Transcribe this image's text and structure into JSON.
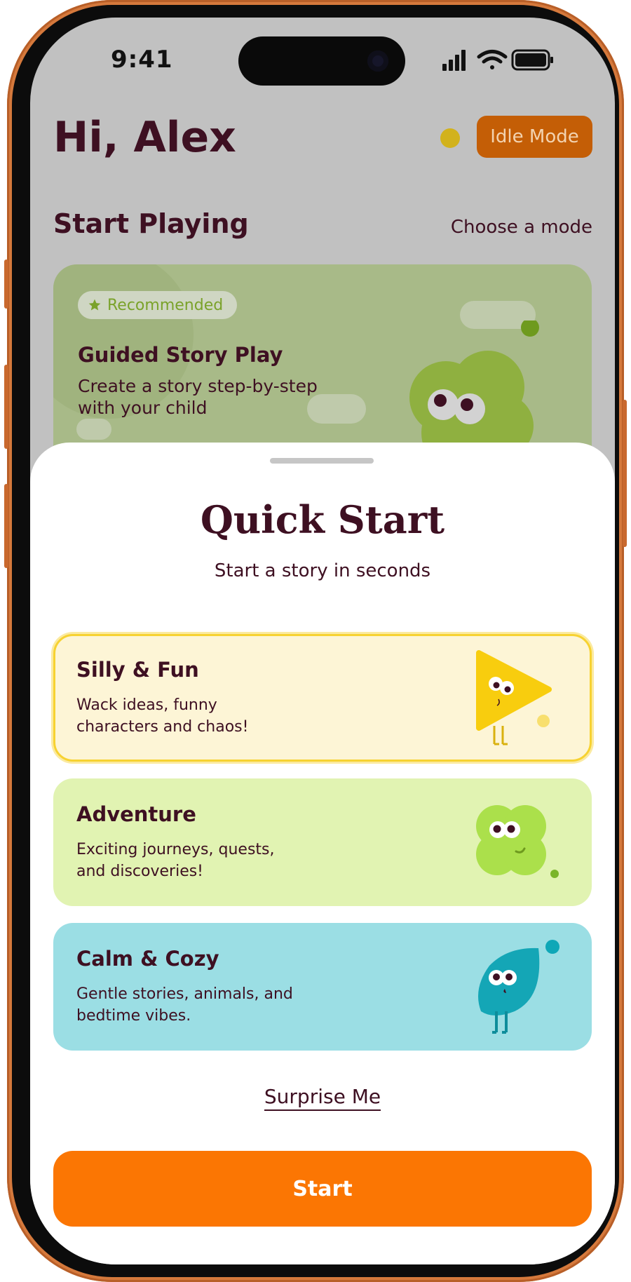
{
  "status_bar": {
    "time": "9:41"
  },
  "header": {
    "greeting": "Hi, Alex",
    "idle_button": "Idle Mode"
  },
  "section": {
    "title": "Start Playing",
    "link": "Choose a mode"
  },
  "recommended_card": {
    "badge": "Recommended",
    "title": "Guided Story Play",
    "description": "Create a story step-by-step with your child"
  },
  "sheet": {
    "title": "Quick Start",
    "subtitle": "Start a story in seconds",
    "modes": [
      {
        "title": "Silly & Fun",
        "description": "Wack ideas, funny characters and chaos!",
        "color": "#fdf5d6",
        "border": "#f7d231",
        "selected": true
      },
      {
        "title": "Adventure",
        "description": "Exciting journeys, quests, and discoveries!",
        "color": "#e1f3b2",
        "selected": false
      },
      {
        "title": "Calm & Cozy",
        "description": "Gentle stories, animals, and bedtime vibes.",
        "color": "#9bdee4",
        "selected": false
      }
    ],
    "surprise_link": "Surprise Me",
    "start_button": "Start"
  },
  "colors": {
    "accent": "#fb7603",
    "text": "#3e1022",
    "idle": "#c45e06"
  }
}
